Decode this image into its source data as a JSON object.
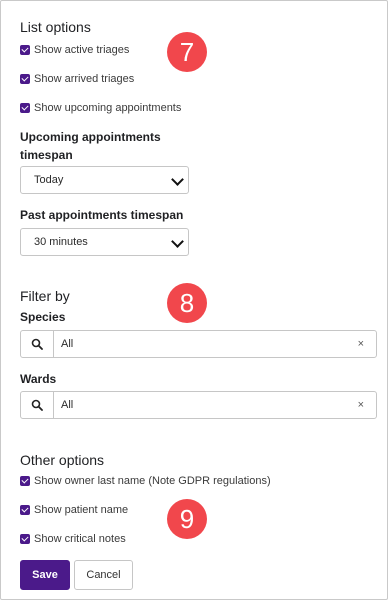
{
  "list_options": {
    "heading": "List options",
    "checkboxes": [
      {
        "label": "Show active triages",
        "checked": true
      },
      {
        "label": "Show arrived triages",
        "checked": true
      },
      {
        "label": "Show upcoming appointments",
        "checked": true
      }
    ],
    "upcoming_label": "Upcoming appointments timespan",
    "upcoming_value": "Today",
    "past_label": "Past appointments timespan",
    "past_value": "30 minutes"
  },
  "filter_by": {
    "heading": "Filter by",
    "species_label": "Species",
    "species_value": "All",
    "wards_label": "Wards",
    "wards_value": "All",
    "clear_glyph": "×"
  },
  "other_options": {
    "heading": "Other options",
    "checkboxes": [
      {
        "label": "Show owner last name (Note GDPR regulations)",
        "checked": true
      },
      {
        "label": "Show patient name",
        "checked": true
      },
      {
        "label": "Show critical notes",
        "checked": true
      }
    ]
  },
  "badges": [
    "7",
    "8",
    "9"
  ],
  "actions": {
    "save": "Save",
    "cancel": "Cancel"
  },
  "colors": {
    "accent": "#4b1a8a",
    "badge": "#f1474c",
    "border": "#c6c6c6"
  }
}
